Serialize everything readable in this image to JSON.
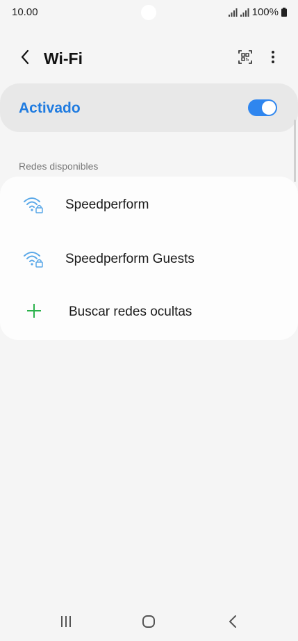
{
  "status_bar": {
    "time": "10.00",
    "battery": "100%"
  },
  "app_bar": {
    "title": "Wi-Fi",
    "back_icon": "back-arrow-icon",
    "qr_icon": "qr-scan-icon",
    "more_icon": "more-vertical-icon"
  },
  "wifi_toggle": {
    "label": "Activado",
    "state": "on",
    "accent": "#1f7be0"
  },
  "networks_section": {
    "header": "Redes disponibles",
    "networks": [
      {
        "name": "Speedperform",
        "icon": "wifi-locked-icon"
      },
      {
        "name": "Speedperform Guests",
        "icon": "wifi-locked-icon"
      }
    ],
    "add_network": {
      "label": "Buscar redes ocultas",
      "icon": "plus-icon",
      "color": "#2bb24c"
    }
  },
  "nav_bar": {
    "recents_icon": "recents-icon",
    "home_icon": "home-icon",
    "back_icon": "nav-back-icon"
  }
}
